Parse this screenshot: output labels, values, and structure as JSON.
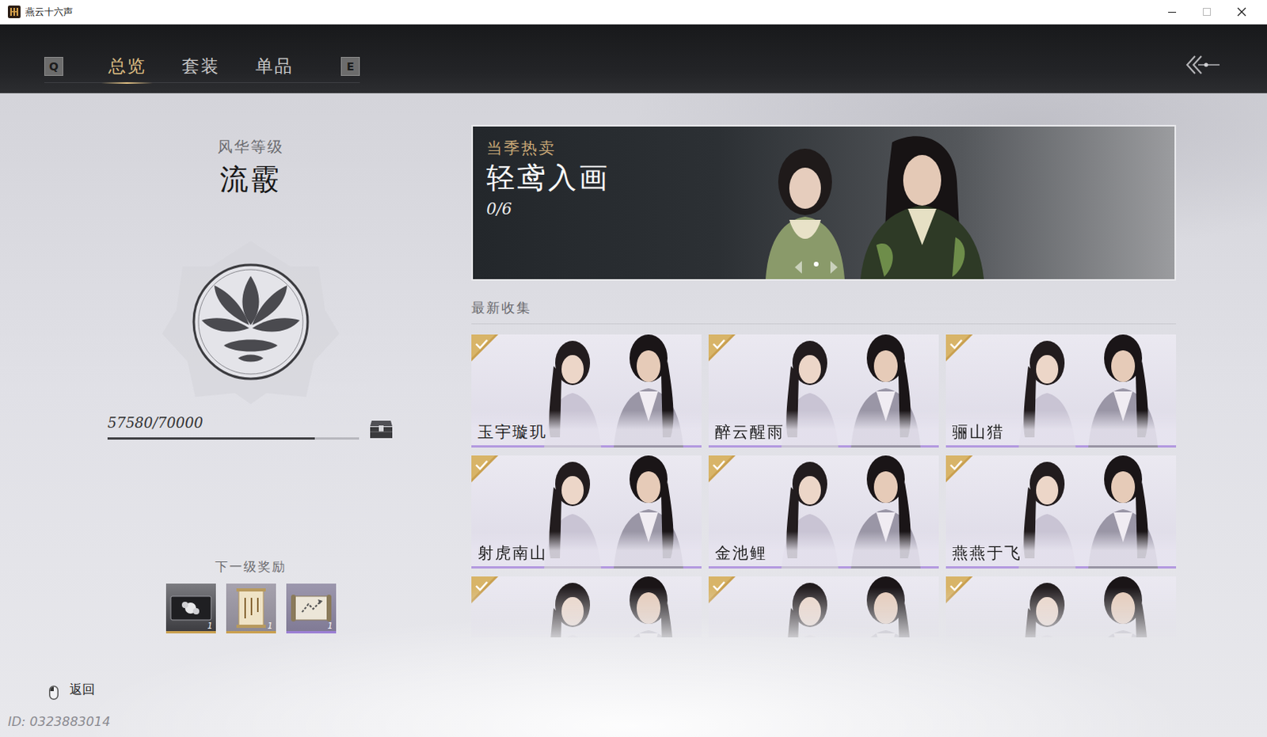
{
  "window": {
    "title": "燕云十六声"
  },
  "nav": {
    "prev_key": "Q",
    "next_key": "E",
    "tabs": [
      {
        "label": "总览",
        "selected": true
      },
      {
        "label": "套装",
        "selected": false
      },
      {
        "label": "单品",
        "selected": false
      }
    ]
  },
  "level_panel": {
    "label": "风华等级",
    "rank": "流霰",
    "progress_text": "57580/70000",
    "level": 0.8226,
    "next_reward_label": "下一级奖励",
    "rewards": [
      {
        "kind": "card",
        "count": "1",
        "color": "#c9a050"
      },
      {
        "kind": "scroll",
        "count": "1",
        "color": "#c9a050"
      },
      {
        "kind": "map",
        "count": "1",
        "color": "#9b7fd4"
      }
    ]
  },
  "banner": {
    "tag": "当季热卖",
    "title": "轻鸢入画",
    "progress": "0/6",
    "slides": [
      {
        "selected": true
      }
    ]
  },
  "recent": {
    "heading": "最新收集",
    "items": [
      {
        "name": "玉宇璇玑",
        "collected": true
      },
      {
        "name": "醉云醒雨",
        "collected": true
      },
      {
        "name": "骊山猎",
        "collected": true
      },
      {
        "name": "射虎南山",
        "collected": true
      },
      {
        "name": "金池鲤",
        "collected": true
      },
      {
        "name": "燕燕于飞",
        "collected": true
      },
      {
        "collected": true
      },
      {
        "collected": true
      },
      {
        "collected": true
      }
    ]
  },
  "footer": {
    "back_label": "返回",
    "id_text": "ID: 0323883014"
  }
}
